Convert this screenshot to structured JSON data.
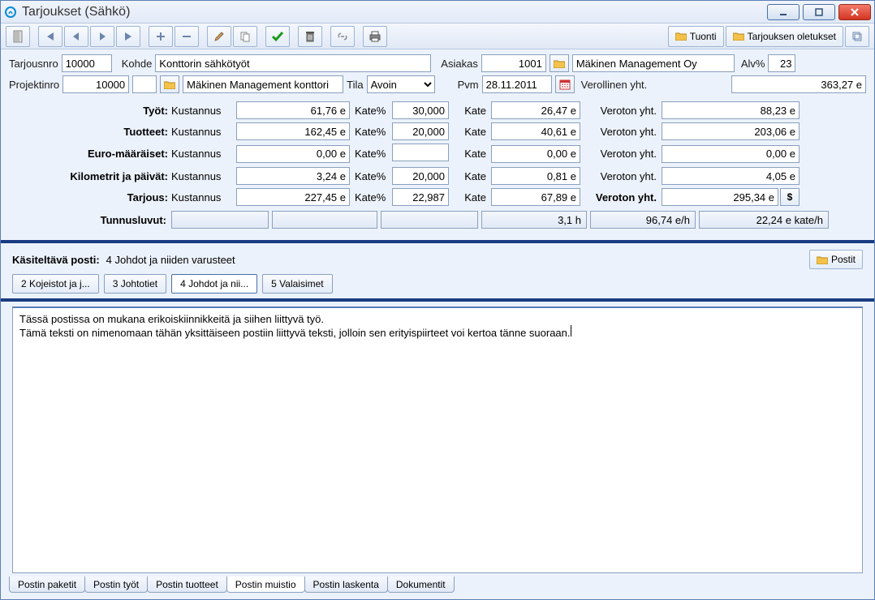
{
  "title": "Tarjoukset (Sähkö)",
  "toolbar": {
    "tuonti": "Tuonti",
    "oletukset": "Tarjouksen oletukset"
  },
  "form": {
    "tarjousnro_lbl": "Tarjousnro",
    "tarjousnro": "10000",
    "kohde_lbl": "Kohde",
    "kohde": "Konttorin sähkötyöt",
    "asiakas_lbl": "Asiakas",
    "asiakas_no": "1001",
    "asiakas_name": "Mäkinen Management Oy",
    "alv_lbl": "Alv%",
    "alv": "23",
    "projektinro_lbl": "Projektinro",
    "projektinro": "10000",
    "proj2": "",
    "projdesc": "Mäkinen Management konttori",
    "tila_lbl": "Tila",
    "tila": "Avoin",
    "pvm_lbl": "Pvm",
    "pvm": "28.11.2011",
    "verollinen_lbl": "Verollinen yht.",
    "verollinen": "363,27 e"
  },
  "sum": {
    "kust": "Kustannus",
    "katep": "Kate%",
    "kate": "Kate",
    "veroton": "Veroton yht.",
    "rows": [
      {
        "name": "Työt:",
        "kust": "61,76 e",
        "katep": "30,000",
        "kate": "26,47 e",
        "ver": "88,23 e"
      },
      {
        "name": "Tuotteet:",
        "kust": "162,45 e",
        "katep": "20,000",
        "kate": "40,61 e",
        "ver": "203,06 e"
      },
      {
        "name": "Euro-määräiset:",
        "kust": "0,00 e",
        "katep": "",
        "kate": "0,00 e",
        "ver": "0,00 e"
      },
      {
        "name": "Kilometrit ja päivät:",
        "kust": "3,24 e",
        "katep": "20,000",
        "kate": "0,81 e",
        "ver": "4,05 e"
      },
      {
        "name": "Tarjous:",
        "kust": "227,45 e",
        "katep": "22,987",
        "kate": "67,89 e",
        "ver": "295,34 e"
      }
    ]
  },
  "tunnus": {
    "lbl": "Tunnusluvut:",
    "v1": "",
    "v2": "",
    "v3": "",
    "v4": "3,1 h",
    "v5": "96,74 e/h",
    "v6": "22,24 e kate/h"
  },
  "post": {
    "lbl": "Käsiteltävä posti:",
    "val": "4 Johdot ja niiden varusteet",
    "btn": "Postit",
    "tabs": [
      "2 Kojeistot ja j...",
      "3 Johtotiet",
      "4 Johdot ja nii...",
      "5 Valaisimet"
    ],
    "active": 2
  },
  "memo": {
    "line1": "Tässä postissa on mukana erikoiskiinnikkeitä ja siihen liittyvä työ.",
    "line2": "Tämä teksti on nimenomaan tähän yksittäiseen postiin liittyvä teksti, jolloin sen erityispiirteet voi kertoa tänne suoraan."
  },
  "btabs": [
    "Postin paketit",
    "Postin työt",
    "Postin tuotteet",
    "Postin muistio",
    "Postin laskenta",
    "Dokumentit"
  ],
  "btab_active": 3
}
